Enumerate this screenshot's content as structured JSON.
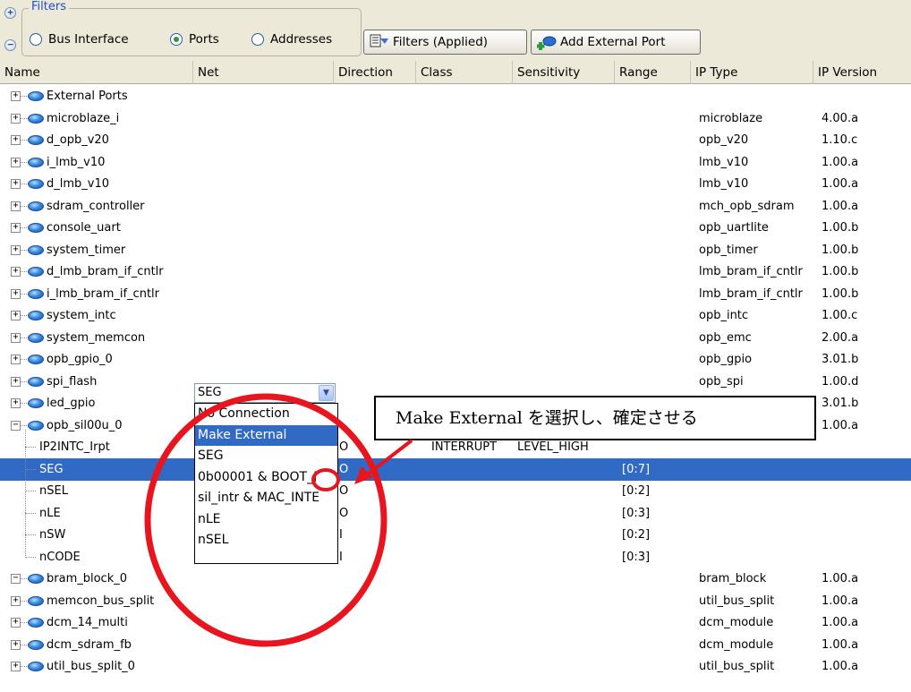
{
  "filters": {
    "legend": "Filters",
    "options": [
      {
        "label": "Bus Interface",
        "checked": false
      },
      {
        "label": "Ports",
        "checked": true
      },
      {
        "label": "Addresses",
        "checked": false
      }
    ],
    "filters_button": "Filters (Applied)",
    "add_port_button": "Add External Port"
  },
  "columns": [
    "Name",
    "Net",
    "Direction",
    "Class",
    "Sensitivity",
    "Range",
    "IP Type",
    "IP Version"
  ],
  "rows": [
    {
      "name": "External Ports",
      "ip_type": "",
      "ip_version": ""
    },
    {
      "name": "microblaze_i",
      "ip_type": "microblaze",
      "ip_version": "4.00.a"
    },
    {
      "name": "d_opb_v20",
      "ip_type": "opb_v20",
      "ip_version": "1.10.c"
    },
    {
      "name": "i_lmb_v10",
      "ip_type": "lmb_v10",
      "ip_version": "1.00.a"
    },
    {
      "name": "d_lmb_v10",
      "ip_type": "lmb_v10",
      "ip_version": "1.00.a"
    },
    {
      "name": "sdram_controller",
      "ip_type": "mch_opb_sdram",
      "ip_version": "1.00.a"
    },
    {
      "name": "console_uart",
      "ip_type": "opb_uartlite",
      "ip_version": "1.00.b"
    },
    {
      "name": "system_timer",
      "ip_type": "opb_timer",
      "ip_version": "1.00.b"
    },
    {
      "name": "d_lmb_bram_if_cntlr",
      "ip_type": "lmb_bram_if_cntlr",
      "ip_version": "1.00.b"
    },
    {
      "name": "i_lmb_bram_if_cntlr",
      "ip_type": "lmb_bram_if_cntlr",
      "ip_version": "1.00.b"
    },
    {
      "name": "system_intc",
      "ip_type": "opb_intc",
      "ip_version": "1.00.c"
    },
    {
      "name": "system_memcon",
      "ip_type": "opb_emc",
      "ip_version": "2.00.a"
    },
    {
      "name": "opb_gpio_0",
      "ip_type": "opb_gpio",
      "ip_version": "3.01.b"
    },
    {
      "name": "spi_flash",
      "ip_type": "opb_spi",
      "ip_version": "1.00.d"
    },
    {
      "name": "led_gpio",
      "ip_type": "",
      "ip_version": "3.01.b"
    },
    {
      "name": "opb_sil00u_0",
      "ip_type": "",
      "ip_version": "1.00.a"
    }
  ],
  "ports": [
    {
      "name": "IP2INTC_Irpt",
      "net": "No Connection",
      "direction": "O",
      "class": "INTERRUPT",
      "sensitivity": "LEVEL_HIGH",
      "range": ""
    },
    {
      "name": "SEG",
      "net": "SEG",
      "direction": "O",
      "class": "",
      "sensitivity": "",
      "range": "[0:7]"
    },
    {
      "name": "nSEL",
      "net": "",
      "direction": "O",
      "class": "",
      "sensitivity": "",
      "range": "[0:2]"
    },
    {
      "name": "nLE",
      "net": "",
      "direction": "O",
      "class": "",
      "sensitivity": "",
      "range": "[0:3]"
    },
    {
      "name": "nSW",
      "net": "",
      "direction": "I",
      "class": "",
      "sensitivity": "",
      "range": "[0:2]"
    },
    {
      "name": "nCODE",
      "net": "",
      "direction": "I",
      "class": "",
      "sensitivity": "",
      "range": "[0:3]"
    }
  ],
  "rows_after": [
    {
      "name": "bram_block_0",
      "ip_type": "bram_block",
      "ip_version": "1.00.a"
    },
    {
      "name": "memcon_bus_split",
      "ip_type": "util_bus_split",
      "ip_version": "1.00.a"
    },
    {
      "name": "dcm_14_multi",
      "ip_type": "dcm_module",
      "ip_version": "1.00.a"
    },
    {
      "name": "dcm_sdram_fb",
      "ip_type": "dcm_module",
      "ip_version": "1.00.a"
    },
    {
      "name": "util_bus_split_0",
      "ip_type": "util_bus_split",
      "ip_version": "1.00.a"
    }
  ],
  "dropdown": [
    "No Connection",
    "Make External",
    "SEG",
    "0b00001 & BOOT_J",
    "sil_intr & MAC_INTE",
    "nLE",
    "nSEL"
  ],
  "dropdown_highlighted": "Make External",
  "callout": "Make External を選択し、確定させる",
  "colors": {
    "selection": "#316ac5",
    "annotation": "#e8141e",
    "legend": "#1f4fc8"
  }
}
